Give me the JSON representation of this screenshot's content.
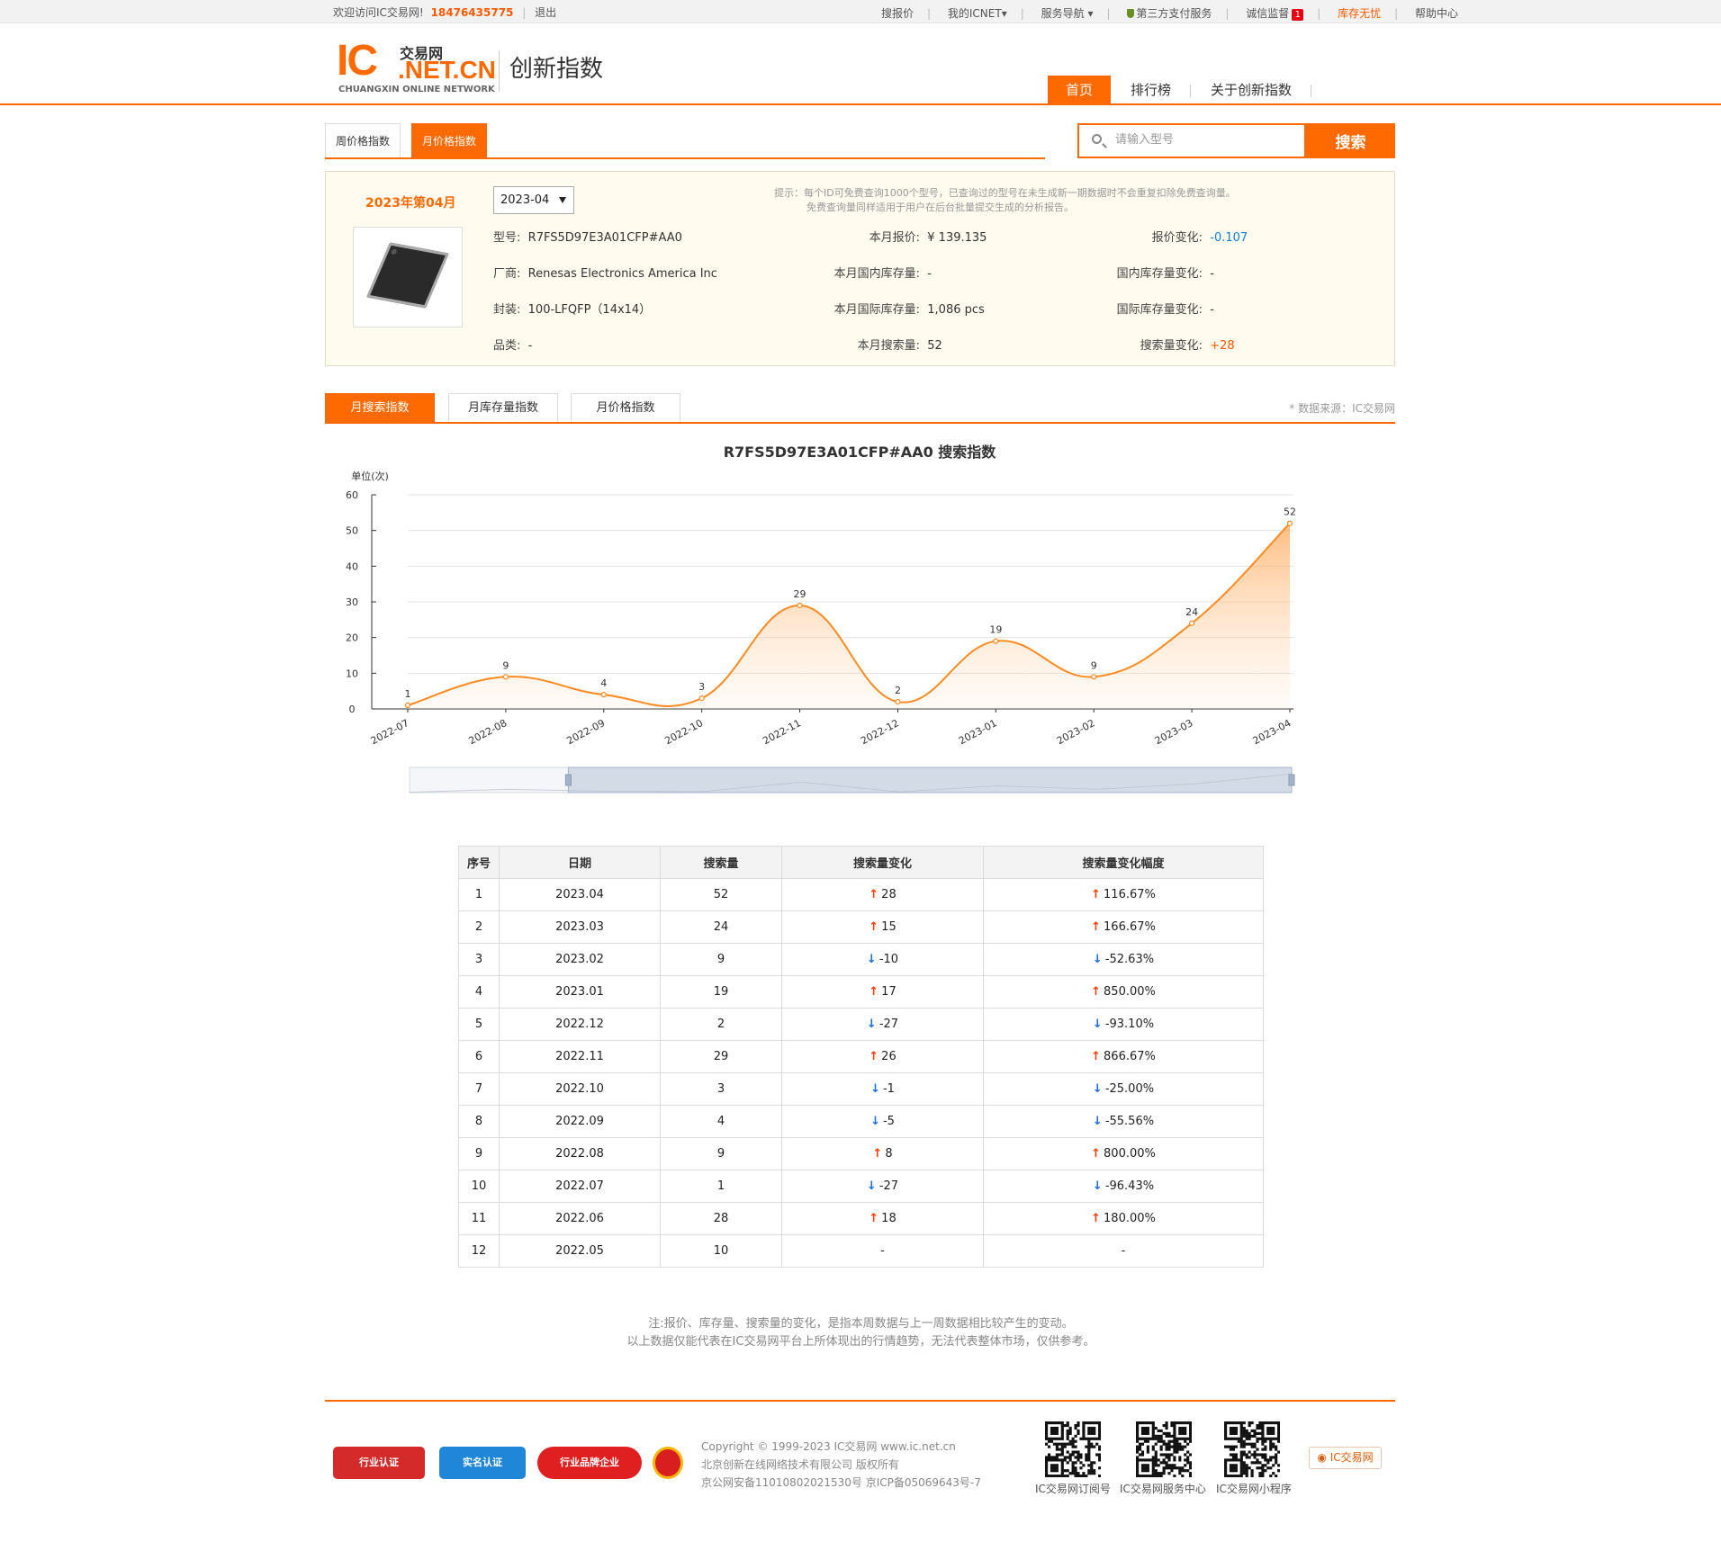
{
  "topbar": {
    "welcome": "欢迎访问IC交易网!",
    "phone": "18476435775",
    "logout": "退出",
    "links": [
      "搜报价",
      "我的ICNET",
      "服务导航",
      "第三方支付服务",
      "诚信监督",
      "库存无忧",
      "帮助中心"
    ],
    "badge_count": "1"
  },
  "header": {
    "logo_ic": "IC",
    "logo_cn": "交易网",
    "logo_net": ".NET.CN",
    "logo_eng": "CHUANGXIN ONLINE NETWORK",
    "site_title": "创新指数",
    "nav": [
      "首页",
      "排行榜",
      "关于创新指数"
    ]
  },
  "index_tabs": [
    "周价格指数",
    "月价格指数"
  ],
  "search": {
    "placeholder": "请输入型号",
    "button": "搜索"
  },
  "info": {
    "period": "2023年第04月",
    "date_select": "2023-04",
    "tip_line1": "提示：每个ID可免费查询1000个型号，已查询过的型号在未生成新一期数据时不会重复扣除免费查询量。",
    "tip_line2": "免费查询量同样适用于用户在后台批量提交生成的分析报告。",
    "model_label": "型号:",
    "model": "R7FS5D97E3A01CFP#AA0",
    "maker_label": "厂商:",
    "maker": "Renesas Electronics America Inc",
    "package_label": "封装:",
    "package": "100-LFQFP（14x14）",
    "category_label": "品类:",
    "category": "-",
    "price_label": "本月报价:",
    "price": "¥ 139.135",
    "dom_stock_label": "本月国内库存量:",
    "dom_stock": "-",
    "intl_stock_label": "本月国际库存量:",
    "intl_stock": "1,086  pcs",
    "search_label": "本月搜索量:",
    "search": "52",
    "price_change_label": "报价变化:",
    "price_change": "-0.107",
    "dom_change_label": "国内库存量变化:",
    "dom_change": "-",
    "intl_change_label": "国际库存量变化:",
    "intl_change": "-",
    "search_change_label": "搜索量变化:",
    "search_change": "+28"
  },
  "metric_tabs": [
    "月搜索指数",
    "月库存量指数",
    "月价格指数"
  ],
  "data_source": "* 数据来源：IC交易网",
  "chart_data": {
    "type": "area",
    "title": "R7FS5D97E3A01CFP#AA0 搜索指数",
    "ylabel": "单位(次)",
    "xlabel": "",
    "categories": [
      "2022-07",
      "2022-08",
      "2022-09",
      "2022-10",
      "2022-11",
      "2022-12",
      "2023-01",
      "2023-02",
      "2023-03",
      "2023-04"
    ],
    "values": [
      1,
      9,
      4,
      3,
      29,
      2,
      19,
      9,
      24,
      52
    ],
    "yticks": [
      0,
      10,
      20,
      30,
      40,
      50,
      60
    ],
    "ylim": [
      0,
      60
    ],
    "color": "#ff8a1f",
    "grid": true,
    "data_labels": true
  },
  "table": {
    "headers": [
      "序号",
      "日期",
      "搜索量",
      "搜索量变化",
      "搜索量变化幅度"
    ],
    "rows": [
      {
        "no": "1",
        "date": "2023.04",
        "count": "52",
        "change": "28",
        "pct": "116.67%",
        "dir": "up",
        "pdir": "up"
      },
      {
        "no": "2",
        "date": "2023.03",
        "count": "24",
        "change": "15",
        "pct": "166.67%",
        "dir": "up",
        "pdir": "up"
      },
      {
        "no": "3",
        "date": "2023.02",
        "count": "9",
        "change": "-10",
        "pct": "-52.63%",
        "dir": "down",
        "pdir": "down"
      },
      {
        "no": "4",
        "date": "2023.01",
        "count": "19",
        "change": "17",
        "pct": "850.00%",
        "dir": "up",
        "pdir": "up"
      },
      {
        "no": "5",
        "date": "2022.12",
        "count": "2",
        "change": "-27",
        "pct": "-93.10%",
        "dir": "down",
        "pdir": "down"
      },
      {
        "no": "6",
        "date": "2022.11",
        "count": "29",
        "change": "26",
        "pct": "866.67%",
        "dir": "up",
        "pdir": "up"
      },
      {
        "no": "7",
        "date": "2022.10",
        "count": "3",
        "change": "-1",
        "pct": "-25.00%",
        "dir": "down",
        "pdir": "down"
      },
      {
        "no": "8",
        "date": "2022.09",
        "count": "4",
        "change": "-5",
        "pct": "-55.56%",
        "dir": "down",
        "pdir": "down"
      },
      {
        "no": "9",
        "date": "2022.08",
        "count": "9",
        "change": "8",
        "pct": "800.00%",
        "dir": "up",
        "pdir": "up"
      },
      {
        "no": "10",
        "date": "2022.07",
        "count": "1",
        "change": "-27",
        "pct": "-96.43%",
        "dir": "down",
        "pdir": "down"
      },
      {
        "no": "11",
        "date": "2022.06",
        "count": "28",
        "change": "18",
        "pct": "180.00%",
        "dir": "up",
        "pdir": "up"
      },
      {
        "no": "12",
        "date": "2022.05",
        "count": "10",
        "change": "-",
        "pct": "-",
        "dir": "none",
        "pdir": "none"
      }
    ]
  },
  "note": {
    "line1": "注:报价、库存量、搜索量的变化，是指本周数据与上一周数据相比较产生的变动。",
    "line2": "以上数据仅能代表在IC交易网平台上所体现出的行情趋势，无法代表整体市场，仅供参考。"
  },
  "footer": {
    "certs": [
      "行业认证",
      "实名认证",
      "行业品牌企业"
    ],
    "copyright": "Copyright © 1999-2023 IC交易网 www.ic.net.cn",
    "company": "北京创新在线网络技术有限公司 版权所有",
    "icp": "京公网安备11010802021530号    京ICP备05069643号-7",
    "qr_labels": [
      "IC交易网订阅号",
      "IC交易网服务中心",
      "IC交易网小程序"
    ],
    "weibo": "IC交易网"
  }
}
